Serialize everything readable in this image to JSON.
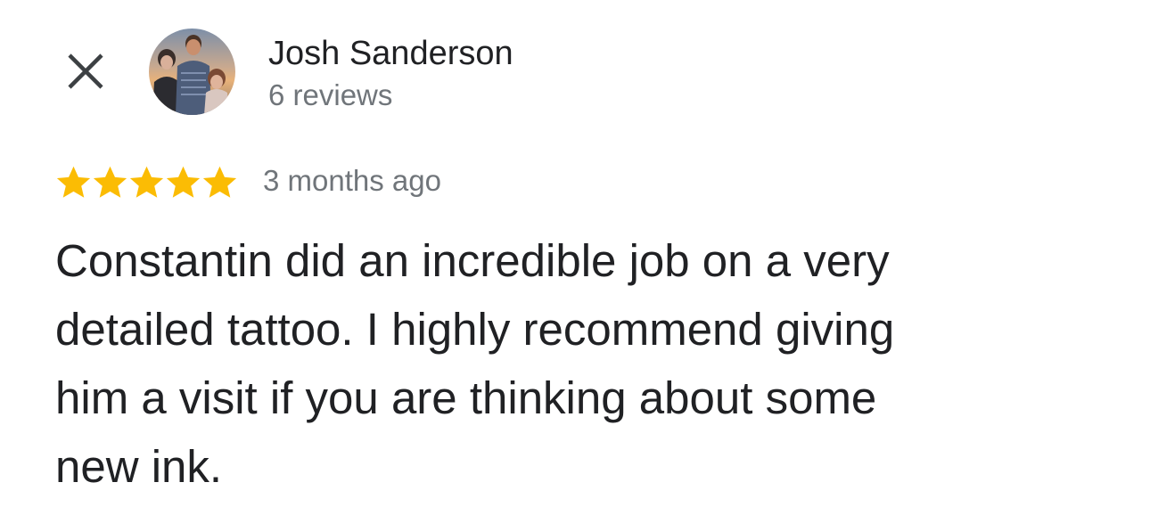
{
  "review": {
    "author": {
      "name": "Josh Sanderson",
      "review_count": "6 reviews",
      "avatar": "profile-photo"
    },
    "close_icon": "close-icon",
    "rating": {
      "value": 5,
      "max": 5,
      "star_color": "#fbbc04"
    },
    "date": "3 months ago",
    "text": "Constantin did an incredible job on a very\ndetailed tattoo.  I highly recommend giving\nhim a visit if you are thinking about some\nnew ink."
  }
}
